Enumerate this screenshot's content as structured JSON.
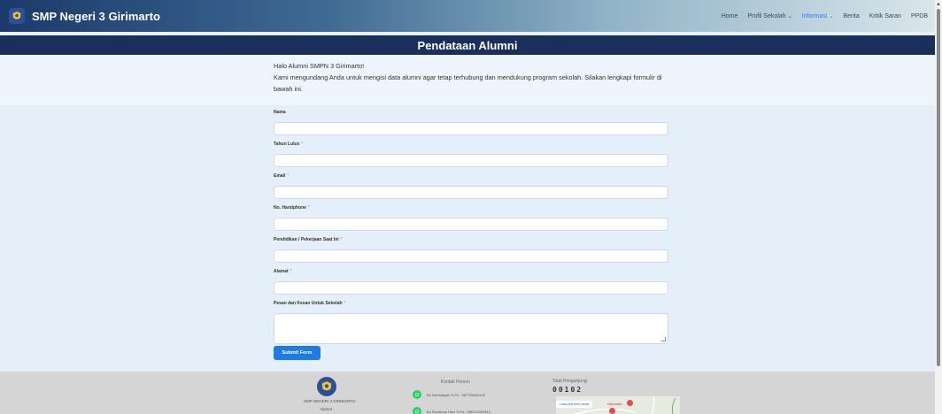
{
  "header": {
    "brand": "SMP Negeri 3 Girimarto",
    "nav": {
      "home": "Home",
      "profil": "Profil Sekolah",
      "informasi": "Informasi",
      "berita": "Berita",
      "kritik": "Kritik Saran",
      "ppdb": "PPDB"
    },
    "accent_color": "#2a7fff"
  },
  "page_title": "Pendataan Alumni",
  "intro": {
    "greeting": "Halo Alumni SMPN 3 Girimarto!",
    "body": "Kami mengundang Anda untuk mengisi data alumni agar tetap terhubung dan mendukung program sekolah. Silakan lengkapi formulir di bawah ini."
  },
  "form": {
    "fields": [
      {
        "label": "Nama",
        "value": ""
      },
      {
        "label": "Tahun Lulus",
        "value": ""
      },
      {
        "label": "Email",
        "value": ""
      },
      {
        "label": "No. Handphone",
        "value": ""
      },
      {
        "label": "Pendidikan / Pekerjaan Saat Ini",
        "value": ""
      },
      {
        "label": "Alamat",
        "value": ""
      },
      {
        "label": "Pesan dan Kesan Untuk Sekolah",
        "value": ""
      }
    ],
    "required_marker": "*",
    "submit_label": "Submit Form",
    "submit_color": "#1e7be6"
  },
  "footer": {
    "school_name": "SMP NEGERI 3 GIRIMARTO",
    "alamat_label": "Alamat :",
    "contact_title": "Kontak Person",
    "contacts": [
      "Bu Nurhidayah S.Pd : 087756055142",
      "Bu Rusdiana Hani S.Pd : 085702009412"
    ],
    "visitor_label": "Total Pengunjung:",
    "visitor_count": "00102",
    "map_link": "Lihat peta lebih besar",
    "map_place": "Girimarto"
  },
  "icons": {
    "logo": "school-crest-icon",
    "whatsapp": "whatsapp-icon",
    "chevron": "chevron-down-icon",
    "scroll_up": "arrow-up-icon"
  }
}
